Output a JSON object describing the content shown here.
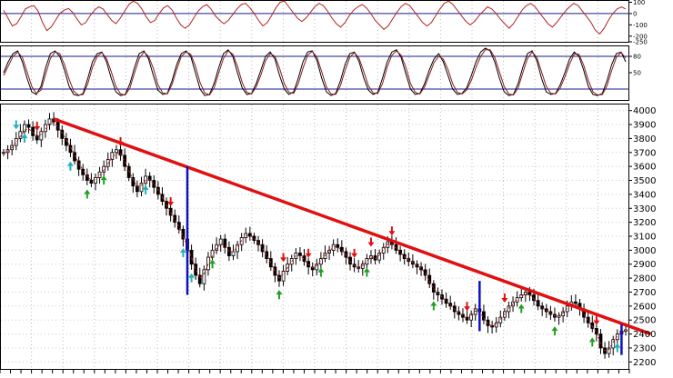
{
  "chart_data": [
    {
      "panel": "oscillator-top",
      "type": "line",
      "ylim": [
        -250,
        120
      ],
      "y_ticks": [
        100,
        0,
        -100,
        -200,
        -250
      ],
      "y_tick_labels": [
        "100",
        "0",
        "-100",
        "-200",
        "-250"
      ],
      "reference_lines": [
        0
      ],
      "series": [
        {
          "color": "#b22222",
          "values": [
            30,
            -40,
            -110,
            -90,
            -30,
            40,
            60,
            70,
            20,
            -80,
            -150,
            -120,
            -60,
            0,
            30,
            45,
            10,
            -50,
            -100,
            -80,
            -20,
            30,
            60,
            40,
            -10,
            -60,
            -90,
            -40,
            20,
            80,
            110,
            90,
            40,
            -30,
            -80,
            -60,
            0,
            50,
            70,
            30,
            -40,
            -100,
            -130,
            -100,
            -40,
            20,
            60,
            80,
            40,
            -20,
            -60,
            -90,
            -60,
            -10,
            40,
            80,
            90,
            50,
            0,
            -60,
            -110,
            -80,
            -20,
            50,
            100,
            110,
            60,
            10,
            -40,
            -70,
            -40,
            10,
            60,
            90,
            70,
            20,
            -40,
            -90,
            -120,
            -80,
            -20,
            30,
            60,
            80,
            50,
            0,
            -60,
            -100,
            -140,
            -110,
            -50,
            10,
            60,
            90,
            70,
            20,
            -30,
            -80,
            -110,
            -80,
            -20,
            40,
            90,
            110,
            80,
            30,
            -20,
            -70,
            -100,
            -70,
            -20,
            20,
            60,
            40,
            0,
            -50,
            -90,
            -130,
            -90,
            -30,
            30,
            70,
            90,
            60,
            10,
            -40,
            -90,
            -120,
            -80,
            -30,
            20,
            60,
            90,
            70,
            20,
            -30,
            -80,
            -150,
            -180,
            -130,
            -60,
            0,
            40,
            60,
            40
          ]
        }
      ]
    },
    {
      "panel": "stochastic",
      "type": "line",
      "ylim": [
        0,
        100
      ],
      "y_ticks": [
        80,
        50
      ],
      "y_tick_labels": [
        "80",
        "50"
      ],
      "reference_lines": [
        80,
        20
      ],
      "series": [
        {
          "color": "#000000",
          "values": [
            50,
            70,
            85,
            90,
            70,
            40,
            15,
            10,
            25,
            60,
            85,
            90,
            80,
            55,
            25,
            10,
            8,
            12,
            40,
            70,
            85,
            88,
            70,
            40,
            15,
            8,
            10,
            30,
            60,
            85,
            90,
            75,
            45,
            18,
            10,
            12,
            35,
            65,
            85,
            90,
            80,
            50,
            20,
            8,
            10,
            30,
            60,
            85,
            92,
            80,
            50,
            22,
            10,
            12,
            30,
            55,
            80,
            88,
            75,
            45,
            20,
            10,
            15,
            40,
            70,
            88,
            90,
            72,
            40,
            15,
            8,
            12,
            35,
            65,
            85,
            88,
            70,
            40,
            18,
            10,
            14,
            40,
            70,
            88,
            92,
            78,
            48,
            20,
            10,
            12,
            30,
            55,
            75,
            85,
            70,
            45,
            20,
            10,
            12,
            22,
            45,
            70,
            88,
            95,
            90,
            70,
            40,
            15,
            8,
            10,
            30,
            60,
            85,
            90,
            72,
            40,
            15,
            10,
            12,
            28,
            50,
            75,
            88,
            80,
            55,
            25,
            10,
            8,
            12,
            35,
            65,
            85,
            88,
            70
          ]
        },
        {
          "color": "#8b1a1a",
          "values": [
            45,
            62,
            80,
            88,
            78,
            52,
            25,
            12,
            18,
            48,
            76,
            88,
            85,
            65,
            38,
            16,
            9,
            10,
            30,
            60,
            80,
            87,
            76,
            52,
            25,
            11,
            9,
            22,
            50,
            76,
            88,
            80,
            58,
            28,
            13,
            11,
            28,
            56,
            80,
            88,
            84,
            62,
            32,
            13,
            9,
            22,
            50,
            76,
            90,
            84,
            62,
            32,
            14,
            11,
            24,
            46,
            72,
            85,
            80,
            58,
            30,
            14,
            12,
            30,
            58,
            82,
            89,
            78,
            52,
            24,
            11,
            10,
            26,
            54,
            78,
            87,
            76,
            52,
            26,
            13,
            12,
            30,
            60,
            82,
            90,
            82,
            60,
            30,
            14,
            11,
            24,
            46,
            68,
            80,
            75,
            56,
            30,
            14,
            11,
            18,
            36,
            60,
            80,
            92,
            92,
            78,
            52,
            25,
            11,
            9,
            22,
            50,
            76,
            88,
            78,
            52,
            25,
            12,
            11,
            22,
            42,
            66,
            84,
            84,
            64,
            36,
            15,
            9,
            10,
            26,
            54,
            78,
            87,
            77
          ]
        }
      ]
    },
    {
      "panel": "price",
      "type": "line",
      "ylim": [
        2150,
        4050
      ],
      "y_ticks": [
        4000,
        3900,
        3800,
        3700,
        3600,
        3500,
        3400,
        3300,
        3200,
        3100,
        3000,
        2900,
        2800,
        2700,
        2600,
        2500,
        2400,
        2300,
        2200
      ],
      "y_tick_labels": [
        "4000",
        "3900",
        "3800",
        "3700",
        "3600",
        "3500",
        "3400",
        "3300",
        "3200",
        "3100",
        "3000",
        "2900",
        "2800",
        "2700",
        "2600",
        "2500",
        "2400",
        "2300",
        "2200"
      ],
      "vertical_grid_count": 20,
      "series": [
        {
          "name": "",
          "color": "#000000",
          "style": "candlestick",
          "values": [
            3700,
            3720,
            3750,
            3800,
            3850,
            3900,
            3880,
            3820,
            3790,
            3850,
            3900,
            3940,
            3920,
            3860,
            3800,
            3750,
            3700,
            3640,
            3580,
            3540,
            3500,
            3480,
            3520,
            3560,
            3600,
            3650,
            3700,
            3720,
            3680,
            3600,
            3520,
            3460,
            3420,
            3480,
            3530,
            3500,
            3450,
            3400,
            3350,
            3300,
            3250,
            3200,
            3150,
            3080,
            3000,
            2900,
            2820,
            2760,
            2860,
            2950,
            3000,
            3040,
            3080,
            3020,
            2960,
            2990,
            3040,
            3090,
            3120,
            3100,
            3070,
            3040,
            2990,
            2940,
            2880,
            2820,
            2780,
            2850,
            2900,
            2940,
            2980,
            2960,
            2920,
            2880,
            2860,
            2900,
            2940,
            2980,
            3000,
            3040,
            3020,
            2990,
            2950,
            2900,
            2880,
            2870,
            2900,
            2940,
            2960,
            2930,
            2980,
            3020,
            3060,
            3040,
            3000,
            2970,
            2940,
            2920,
            2900,
            2880,
            2860,
            2820,
            2760,
            2700,
            2680,
            2650,
            2620,
            2600,
            2560,
            2540,
            2520,
            2500,
            2540,
            2580,
            2560,
            2500,
            2460,
            2450,
            2480,
            2520,
            2560,
            2600,
            2630,
            2660,
            2680,
            2700,
            2680,
            2640,
            2600,
            2580,
            2560,
            2540,
            2520,
            2530,
            2560,
            2600,
            2630,
            2620,
            2580,
            2520,
            2480,
            2440,
            2400,
            2300,
            2260,
            2300,
            2360,
            2400,
            2420,
            2430
          ]
        },
        {
          "color": "#b22222",
          "style": "dashed",
          "values": [
            3690,
            3710,
            3735,
            3770,
            3815,
            3860,
            3870,
            3845,
            3815,
            3830,
            3865,
            3905,
            3915,
            3885,
            3840,
            3790,
            3740,
            3685,
            3625,
            3575,
            3530,
            3500,
            3505,
            3535,
            3575,
            3620,
            3665,
            3695,
            3690,
            3640,
            3570,
            3505,
            3455,
            3465,
            3500,
            3505,
            3475,
            3430,
            3380,
            3325,
            3275,
            3220,
            3165,
            3100,
            3030,
            2945,
            2865,
            2800,
            2830,
            2900,
            2960,
            3010,
            3050,
            3035,
            2990,
            2990,
            3025,
            3070,
            3105,
            3105,
            3085,
            3055,
            3015,
            2965,
            2910,
            2850,
            2800,
            2830,
            2875,
            2920,
            2960,
            2960,
            2935,
            2900,
            2875,
            2890,
            2925,
            2965,
            2990,
            3025,
            3025,
            3000,
            2965,
            2920,
            2890,
            2875,
            2890,
            2925,
            2950,
            2940,
            2965,
            3005,
            3045,
            3045,
            3015,
            2985,
            2955,
            2930,
            2910,
            2890,
            2870,
            2835,
            2780,
            2725,
            2695,
            2665,
            2635,
            2610,
            2575,
            2550,
            2530,
            2510,
            2530,
            2565,
            2560,
            2515,
            2475,
            2455,
            2470,
            2505,
            2545,
            2585,
            2615,
            2645,
            2670,
            2690,
            2685,
            2655,
            2615,
            2590,
            2570,
            2550,
            2530,
            2530,
            2550,
            2585,
            2615,
            2620,
            2590,
            2540,
            2495,
            2455,
            2415,
            2330,
            2280,
            2290,
            2340,
            2385,
            2410,
            2425
          ]
        }
      ],
      "trendline": {
        "color": "#e01010",
        "from": {
          "index": 12,
          "value": 3940
        },
        "to": {
          "index": 155,
          "value": 2400
        }
      },
      "vertical_markers": [
        {
          "color": "#1010c0",
          "index": 44,
          "from": 3600,
          "to": 2680
        },
        {
          "color": "#1010c0",
          "index": 114,
          "from": 2780,
          "to": 2420
        },
        {
          "color": "#1010c0",
          "index": 148,
          "from": 2470,
          "to": 2250
        }
      ],
      "signals": {
        "down": [
          8,
          28,
          40,
          67,
          73,
          84,
          88,
          93,
          111,
          120,
          142
        ],
        "up": [
          20,
          24,
          50,
          66,
          76,
          87,
          103,
          124,
          132,
          141
        ],
        "cyan_up": [
          5,
          16,
          34,
          43,
          45,
          147
        ],
        "cyan_down": [
          3
        ]
      }
    }
  ]
}
